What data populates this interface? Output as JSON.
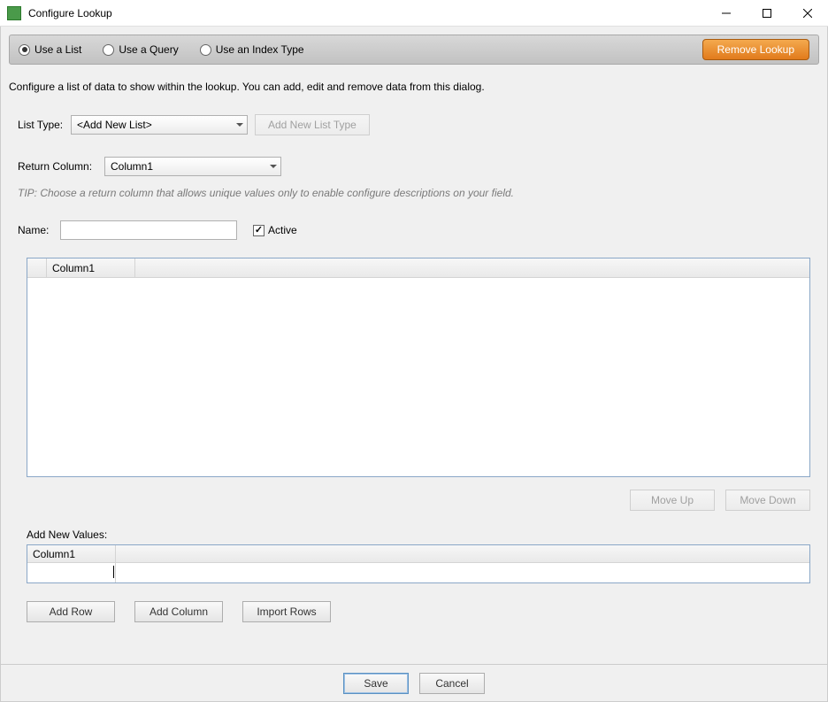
{
  "window": {
    "title": "Configure Lookup"
  },
  "radiobar": {
    "options": [
      "Use a List",
      "Use a Query",
      "Use an Index Type"
    ],
    "selected_index": 0,
    "remove_label": "Remove Lookup"
  },
  "description": "Configure a list of data to show within the lookup. You can add, edit and remove data from this dialog.",
  "list_type": {
    "label": "List Type:",
    "selected": "<Add New List>",
    "add_button": "Add New List Type"
  },
  "return_column": {
    "label": "Return Column:",
    "selected": "Column1",
    "tip": "TIP: Choose a return column that allows unique values only to enable configure descriptions on your field."
  },
  "name_row": {
    "label": "Name:",
    "value": "",
    "active_label": "Active",
    "active_checked": true
  },
  "grid": {
    "columns": [
      "Column1"
    ]
  },
  "move_buttons": {
    "up": "Move Up",
    "down": "Move Down"
  },
  "add_new": {
    "label": "Add New Values:",
    "columns": [
      "Column1"
    ]
  },
  "row_buttons": {
    "add_row": "Add Row",
    "add_column": "Add Column",
    "import_rows": "Import Rows"
  },
  "footer": {
    "save": "Save",
    "cancel": "Cancel"
  }
}
